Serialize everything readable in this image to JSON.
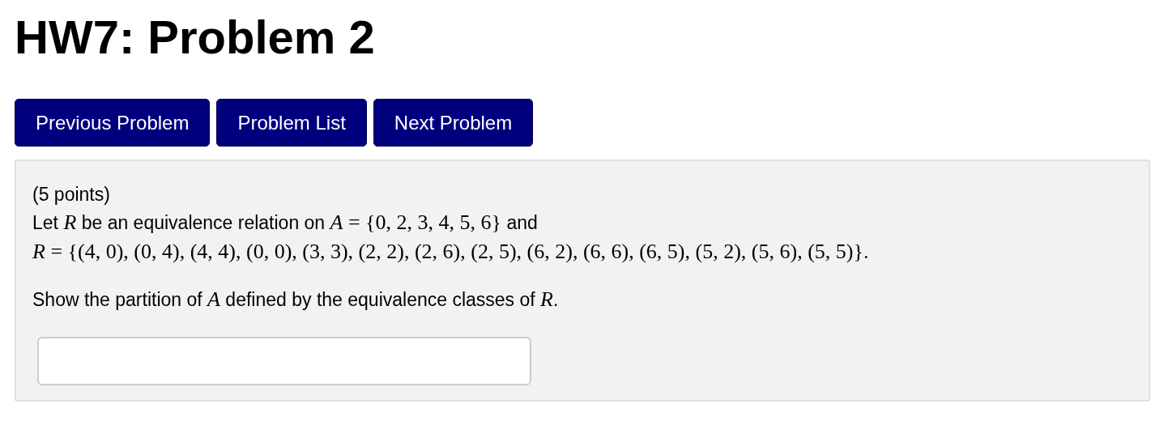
{
  "title": "HW7: Problem 2",
  "nav_buttons": [
    "Previous Problem",
    "Problem List",
    "Next Problem"
  ],
  "problem": {
    "points": "(5 points)",
    "statement_lines": [
      [
        {
          "kind": "text",
          "text": "Let "
        },
        {
          "kind": "math",
          "text": "*R*"
        },
        {
          "kind": "text",
          "text": " be an equivalence relation on "
        },
        {
          "kind": "math",
          "text": "*A* = {0, 2, 3, 4, 5, 6}"
        },
        {
          "kind": "text",
          "text": " and"
        }
      ],
      [
        {
          "kind": "math",
          "text": "*R* = {(4, 0), (0, 4), (4, 4), (0, 0), (3, 3), (2, 2), (2, 6), (2, 5), (6, 2), (6, 6), (6, 5), (5, 2), (5, 6), (5, 5)}."
        }
      ]
    ],
    "question": [
      {
        "kind": "text",
        "text": "Show the partition of "
      },
      {
        "kind": "math",
        "text": "*A*"
      },
      {
        "kind": "text",
        "text": " defined by the equivalence classes of "
      },
      {
        "kind": "math",
        "text": "*R*"
      },
      {
        "kind": "text",
        "text": "."
      }
    ]
  }
}
